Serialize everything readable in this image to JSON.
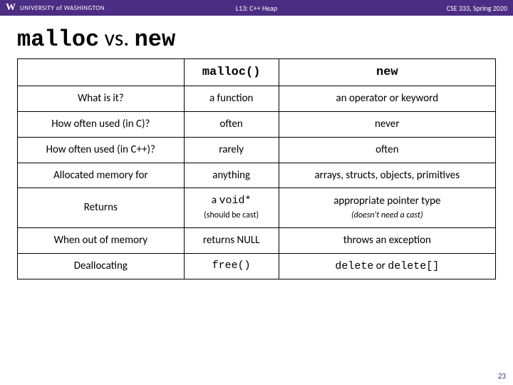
{
  "topbar": {
    "logo_letter": "W",
    "university": "UNIVERSITY of WASHINGTON",
    "lecture": "L13: C++ Heap",
    "course": "CSE 333, Spring 2020"
  },
  "title": {
    "code1": "malloc",
    "vs": " vs. ",
    "code2": "new"
  },
  "table": {
    "col_malloc": "malloc()",
    "col_new": "new",
    "row1": {
      "label": "What is it?",
      "malloc": "a function",
      "new": "an operator or keyword"
    },
    "row2": {
      "label": "How often used (in C)?",
      "malloc": "often",
      "new": "never"
    },
    "row3": {
      "label": "How often used (in C++)?",
      "malloc": "rarely",
      "new": "often"
    },
    "row4": {
      "label": "Allocated memory for",
      "malloc": "anything",
      "new": "arrays, structs, objects, primitives"
    },
    "row5": {
      "label": "Returns",
      "malloc_main": "a void*",
      "malloc_sub": "(should be cast)",
      "new_main": "appropriate pointer type",
      "new_sub": "(doesn't need a cast)"
    },
    "row6": {
      "label": "When out of memory",
      "malloc": "returns NULL",
      "new": "throws an exception"
    },
    "row7": {
      "label": "Deallocating",
      "malloc": "free()",
      "new_code1": "delete",
      "new_or": " or ",
      "new_code2": "delete[]"
    }
  },
  "page_number": "23"
}
